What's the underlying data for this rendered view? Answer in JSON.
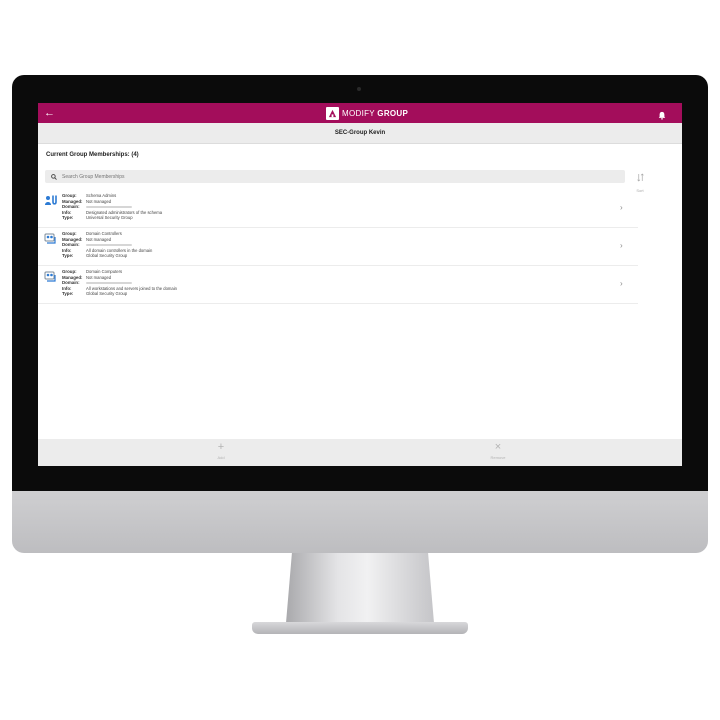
{
  "app": {
    "title_light": "MODIFY",
    "title_bold": "GROUP"
  },
  "subheader": {
    "title": "SEC-Group Kevin"
  },
  "memberships": {
    "heading": "Current Group Memberships: (4)",
    "search_placeholder": "Search Group Memberships",
    "sort_label": "Sort",
    "field_labels": {
      "group": "Group:",
      "managed": "Managed:",
      "domain": "Domain:",
      "info": "Info:",
      "type": "Type:"
    },
    "items": [
      {
        "icon": "schema-admin-group-icon",
        "group": "Schema Admins",
        "managed": "Not managed",
        "domain": "",
        "info": "Designated administrators of the schema",
        "type": "Universal Security Group"
      },
      {
        "icon": "security-group-icon",
        "group": "Domain Controllers",
        "managed": "Not managed",
        "domain": "",
        "info": "All domain controllers in the domain",
        "type": "Global Security Group"
      },
      {
        "icon": "security-group-icon",
        "group": "Domain Computers",
        "managed": "Not managed",
        "domain": "",
        "info": "All workstations and servers joined to the domain",
        "type": "Global Security Group"
      }
    ]
  },
  "toolbar": {
    "add_label": "Add",
    "remove_label": "Remove"
  },
  "colors": {
    "accent": "#a30d5b",
    "bar_gray": "#ececec",
    "icon_blue": "#2d7bd4"
  }
}
